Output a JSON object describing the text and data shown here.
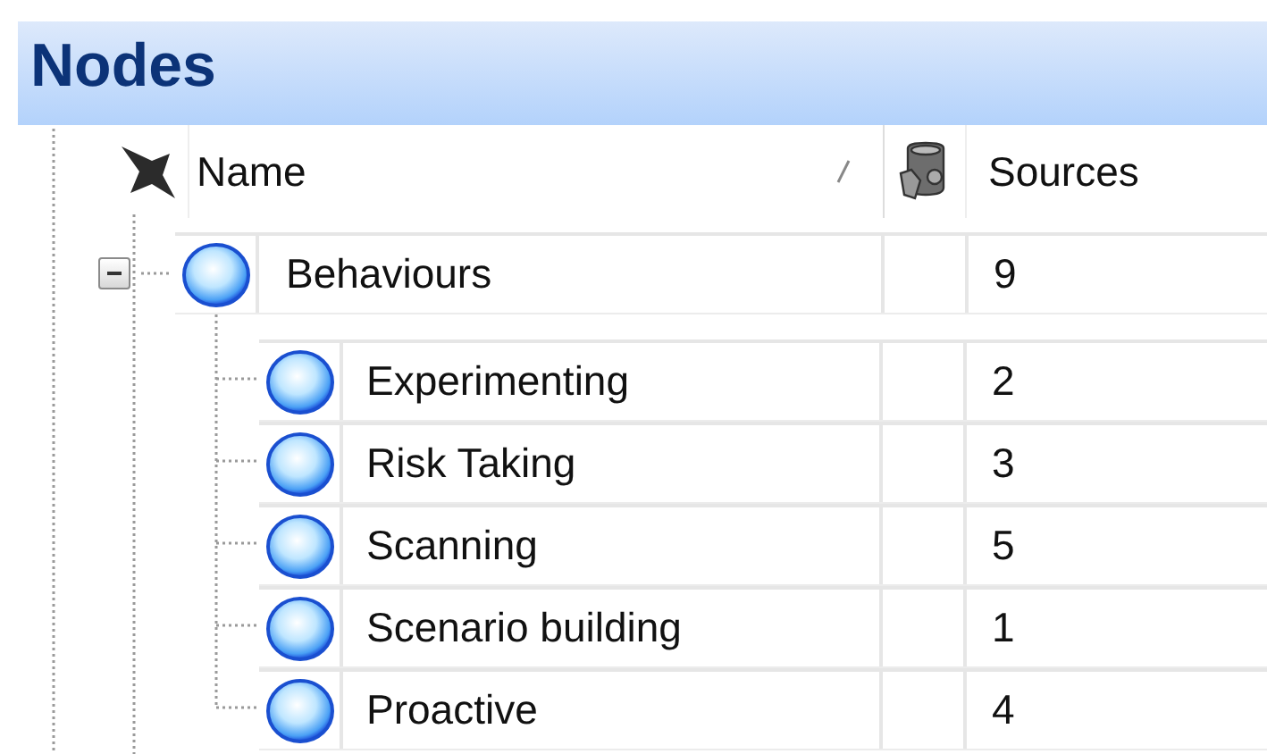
{
  "panel": {
    "title": "Nodes"
  },
  "columns": [
    {
      "kind": "name",
      "label": "Name"
    },
    {
      "kind": "sources",
      "label": "Sources"
    }
  ],
  "nodes": [
    {
      "name": "Behaviours",
      "sources": "9",
      "expanded": true,
      "children": [
        {
          "name": "Experimenting",
          "sources": "2"
        },
        {
          "name": "Risk Taking",
          "sources": "3"
        },
        {
          "name": "Scanning",
          "sources": "5"
        },
        {
          "name": "Scenario building",
          "sources": "1"
        },
        {
          "name": "Proactive",
          "sources": "4"
        }
      ]
    }
  ]
}
